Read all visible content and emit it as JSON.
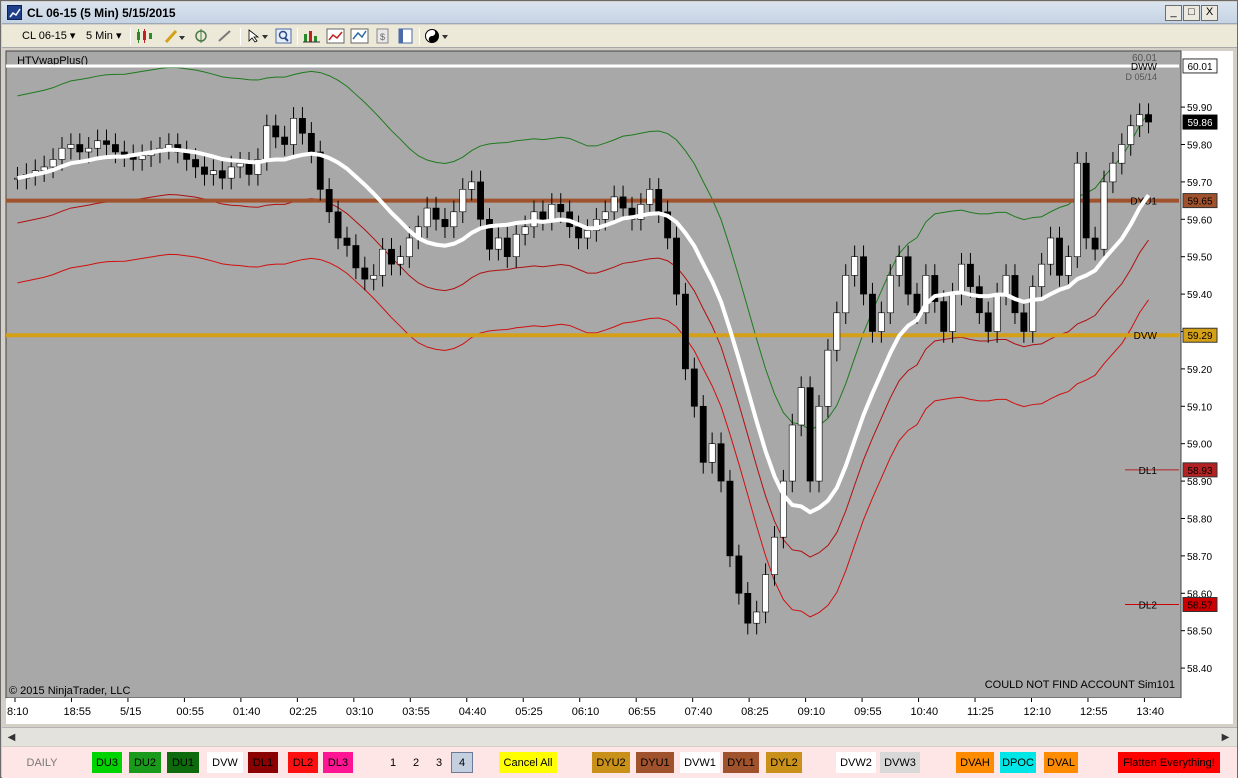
{
  "window": {
    "title": "CL 06-15 (5 Min)  5/15/2015",
    "buttons": [
      "_",
      "□",
      "X"
    ]
  },
  "toolbar": {
    "instrument": "CL 06-15",
    "interval": "5 Min",
    "icons": [
      "candlestick-style-icon",
      "draw-pencil-icon",
      "pan-cursor-icon",
      "zoom-icon",
      "pointer-icon",
      "magnify-icon",
      "bar-data-icon",
      "indicators-icon",
      "strategies-icon",
      "properties-icon",
      "templates-icon",
      "yin-yang-icon"
    ]
  },
  "chart_data": {
    "type": "candlestick",
    "indicator_label": "_HTVwapPlus()",
    "copyright": "© 2015 NinjaTrader, LLC",
    "status_text": "COULD NOT FIND ACCOUNT Sim101",
    "ylim": [
      58.32,
      60.05
    ],
    "y_ticks": [
      "59.90",
      "59.80",
      "59.70",
      "59.60",
      "59.50",
      "59.40",
      "59.30",
      "59.20",
      "59.10",
      "59.00",
      "58.90",
      "58.80",
      "58.70",
      "58.60",
      "58.50",
      "58.40"
    ],
    "x_ticks": [
      "8:10",
      "18:55",
      "5/15",
      "00:55",
      "01:40",
      "02:25",
      "03:10",
      "03:55",
      "04:40",
      "05:25",
      "06:10",
      "06:55",
      "07:40",
      "08:25",
      "09:10",
      "09:55",
      "10:40",
      "11:25",
      "12:10",
      "12:55",
      "13:40"
    ],
    "horizontal_levels": [
      {
        "name": "DW",
        "value": 60.01,
        "color": "#ffffff",
        "right_label": "DWW",
        "right_label_sub": "D 05/14",
        "marker": "60.01",
        "marker_text_top": "60.01"
      },
      {
        "name": "DYU1",
        "value": 59.65,
        "color": "#a0522d",
        "right_label": "DYU1",
        "marker": "59.65"
      },
      {
        "name": "DVW",
        "value": 59.29,
        "color": "#d4a017",
        "right_label": "DVW",
        "marker": "59.29"
      },
      {
        "name": "DL1",
        "value": 58.93,
        "color": "#b22222",
        "right_label": "DL1",
        "marker": "58.93"
      },
      {
        "name": "DL2",
        "value": 58.57,
        "color": "#cc0000",
        "right_label": "DL2",
        "marker": "58.57"
      }
    ],
    "last_price": {
      "value": 59.86,
      "marker": "59.86"
    },
    "candles_close": [
      59.71,
      59.72,
      59.73,
      59.74,
      59.76,
      59.79,
      59.8,
      59.78,
      59.79,
      59.81,
      59.8,
      59.78,
      59.77,
      59.76,
      59.77,
      59.78,
      59.79,
      59.8,
      59.78,
      59.76,
      59.74,
      59.72,
      59.73,
      59.71,
      59.74,
      59.75,
      59.72,
      59.76,
      59.85,
      59.82,
      59.8,
      59.87,
      59.83,
      59.78,
      59.68,
      59.62,
      59.55,
      59.53,
      59.47,
      59.44,
      59.45,
      59.52,
      59.48,
      59.5,
      59.55,
      59.58,
      59.63,
      59.6,
      59.58,
      59.62,
      59.68,
      59.7,
      59.6,
      59.52,
      59.55,
      59.5,
      59.56,
      59.58,
      59.62,
      59.6,
      59.64,
      59.62,
      59.58,
      59.55,
      59.57,
      59.6,
      59.62,
      59.66,
      59.63,
      59.6,
      59.64,
      59.68,
      59.62,
      59.55,
      59.4,
      59.2,
      59.1,
      58.95,
      59.0,
      58.9,
      58.7,
      58.6,
      58.52,
      58.55,
      58.65,
      58.75,
      58.9,
      59.05,
      59.15,
      58.9,
      59.1,
      59.25,
      59.35,
      59.45,
      59.5,
      59.4,
      59.3,
      59.35,
      59.45,
      59.5,
      59.4,
      59.35,
      59.45,
      59.38,
      59.3,
      59.4,
      59.48,
      59.42,
      59.35,
      59.3,
      59.4,
      59.45,
      59.35,
      59.3,
      59.42,
      59.48,
      59.55,
      59.45,
      59.5,
      59.75,
      59.55,
      59.52,
      59.7,
      59.75,
      59.8,
      59.85,
      59.88,
      59.86
    ],
    "series": [
      {
        "name": "HTVwap",
        "color": "#ffffff"
      },
      {
        "name": "Upper band 1",
        "color": "#1e7a1e"
      },
      {
        "name": "Lower band 1",
        "color": "#b01010"
      },
      {
        "name": "Lower band 2",
        "color": "#d01010"
      }
    ]
  },
  "button_bar": {
    "buttons": [
      {
        "label": "DAILY",
        "bg": "#ffe6e6",
        "fg": "#777777"
      },
      {
        "label": "DU3",
        "bg": "#00d400",
        "fg": "#000000"
      },
      {
        "label": "DU2",
        "bg": "#1a9a1a",
        "fg": "#000000"
      },
      {
        "label": "DU1",
        "bg": "#0d6a0d",
        "fg": "#000000"
      },
      {
        "label": "DVW",
        "bg": "#ffffff",
        "fg": "#000000"
      },
      {
        "label": "DL1",
        "bg": "#8b0000",
        "fg": "#000000"
      },
      {
        "label": "DL2",
        "bg": "#ff1010",
        "fg": "#000000"
      },
      {
        "label": "DL3",
        "bg": "#ff1493",
        "fg": "#000000"
      },
      {
        "label": "1",
        "bg": "#ffe6e6",
        "fg": "#000000"
      },
      {
        "label": "2",
        "bg": "#ffe6e6",
        "fg": "#000000"
      },
      {
        "label": "3",
        "bg": "#ffe6e6",
        "fg": "#000000"
      },
      {
        "label": "4",
        "bg": "#c4cfe0",
        "fg": "#000000"
      },
      {
        "label": "Cancel All",
        "bg": "#ffff00",
        "fg": "#000000"
      },
      {
        "label": "DYU2",
        "bg": "#c9901a",
        "fg": "#000000"
      },
      {
        "label": "DYU1",
        "bg": "#a0522d",
        "fg": "#000000"
      },
      {
        "label": "DVW1",
        "bg": "#ffffff",
        "fg": "#000000"
      },
      {
        "label": "DYL1",
        "bg": "#a0522d",
        "fg": "#000000"
      },
      {
        "label": "DYL2",
        "bg": "#c9901a",
        "fg": "#000000"
      },
      {
        "label": "DVW2",
        "bg": "#ffffff",
        "fg": "#000000"
      },
      {
        "label": "DVW3",
        "bg": "#d8d8d8",
        "fg": "#000000"
      },
      {
        "label": "DVAH",
        "bg": "#ff8c00",
        "fg": "#000000"
      },
      {
        "label": "DPOC",
        "bg": "#00e5e5",
        "fg": "#000000"
      },
      {
        "label": "DVAL",
        "bg": "#ff8c00",
        "fg": "#000000"
      },
      {
        "label": "Flatten Everything!",
        "bg": "#ff0000",
        "fg": "#000000"
      }
    ]
  }
}
